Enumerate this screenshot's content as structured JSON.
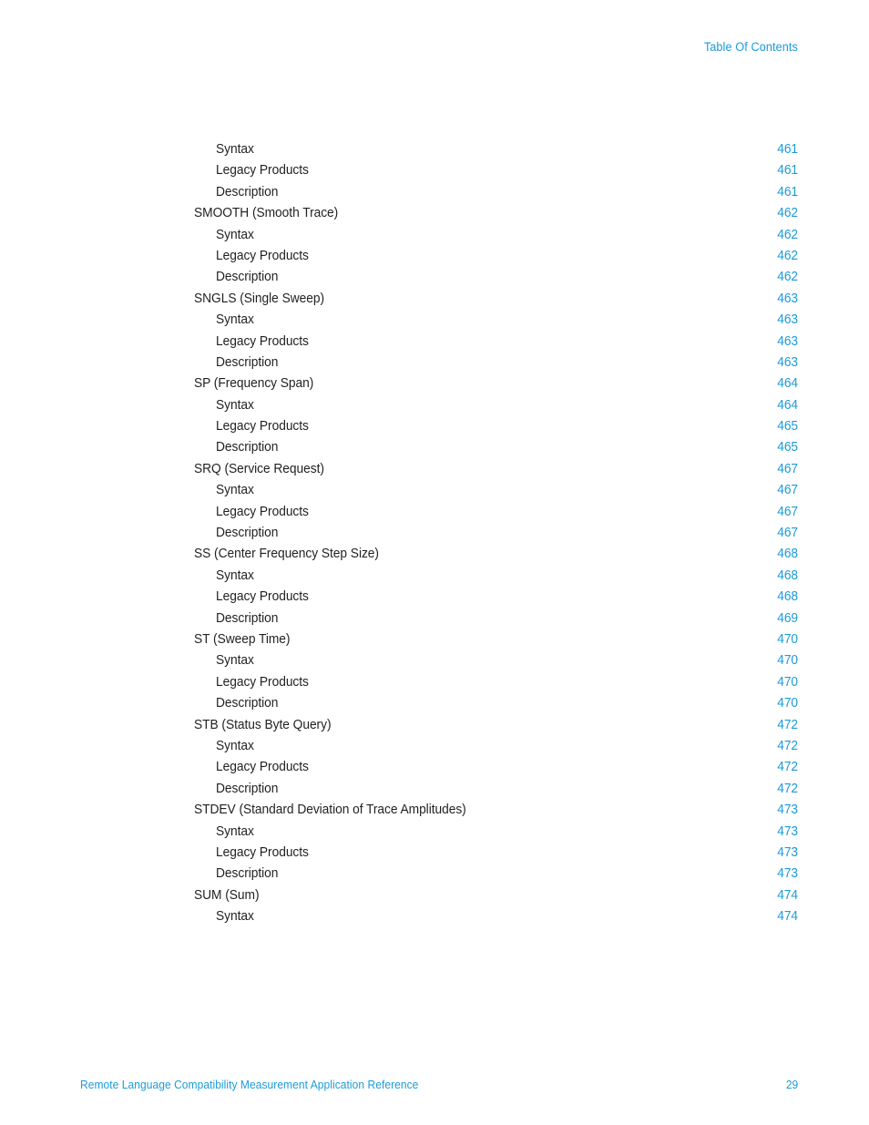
{
  "document": {
    "header_title": "Table Of Contents",
    "footer_title": "Remote Language Compatibility Measurement Application Reference",
    "folio": "29",
    "accent_color": "#1B9BD8",
    "text_color": "#231F20",
    "background_color": "#FFFFFF"
  },
  "toc": {
    "entries": [
      {
        "label": "Syntax",
        "page": "461",
        "level": 2
      },
      {
        "label": "Legacy Products",
        "page": "461",
        "level": 2
      },
      {
        "label": "Description",
        "page": "461",
        "level": 2
      },
      {
        "label": "SMOOTH (Smooth Trace)",
        "page": "462",
        "level": 1
      },
      {
        "label": "Syntax",
        "page": "462",
        "level": 2
      },
      {
        "label": "Legacy Products",
        "page": "462",
        "level": 2
      },
      {
        "label": "Description",
        "page": "462",
        "level": 2
      },
      {
        "label": "SNGLS (Single Sweep)",
        "page": "463",
        "level": 1
      },
      {
        "label": "Syntax",
        "page": "463",
        "level": 2
      },
      {
        "label": "Legacy Products",
        "page": "463",
        "level": 2
      },
      {
        "label": "Description",
        "page": "463",
        "level": 2
      },
      {
        "label": "SP (Frequency Span)",
        "page": "464",
        "level": 1
      },
      {
        "label": "Syntax",
        "page": "464",
        "level": 2
      },
      {
        "label": "Legacy Products",
        "page": "465",
        "level": 2
      },
      {
        "label": "Description",
        "page": "465",
        "level": 2
      },
      {
        "label": "SRQ (Service Request)",
        "page": "467",
        "level": 1
      },
      {
        "label": "Syntax",
        "page": "467",
        "level": 2
      },
      {
        "label": "Legacy Products",
        "page": "467",
        "level": 2
      },
      {
        "label": "Description",
        "page": "467",
        "level": 2
      },
      {
        "label": "SS (Center Frequency Step Size)",
        "page": "468",
        "level": 1
      },
      {
        "label": "Syntax",
        "page": "468",
        "level": 2
      },
      {
        "label": "Legacy Products",
        "page": "468",
        "level": 2
      },
      {
        "label": "Description",
        "page": "469",
        "level": 2
      },
      {
        "label": "ST (Sweep Time)",
        "page": "470",
        "level": 1
      },
      {
        "label": "Syntax",
        "page": "470",
        "level": 2
      },
      {
        "label": "Legacy Products",
        "page": "470",
        "level": 2
      },
      {
        "label": "Description",
        "page": "470",
        "level": 2
      },
      {
        "label": "STB (Status Byte Query)",
        "page": "472",
        "level": 1
      },
      {
        "label": "Syntax",
        "page": "472",
        "level": 2
      },
      {
        "label": "Legacy Products",
        "page": "472",
        "level": 2
      },
      {
        "label": "Description",
        "page": "472",
        "level": 2
      },
      {
        "label": "STDEV (Standard Deviation of Trace Amplitudes)",
        "page": "473",
        "level": 1
      },
      {
        "label": "Syntax",
        "page": "473",
        "level": 2
      },
      {
        "label": "Legacy Products",
        "page": "473",
        "level": 2
      },
      {
        "label": "Description",
        "page": "473",
        "level": 2
      },
      {
        "label": "SUM (Sum)",
        "page": "474",
        "level": 1
      },
      {
        "label": "Syntax",
        "page": "474",
        "level": 2
      }
    ]
  }
}
